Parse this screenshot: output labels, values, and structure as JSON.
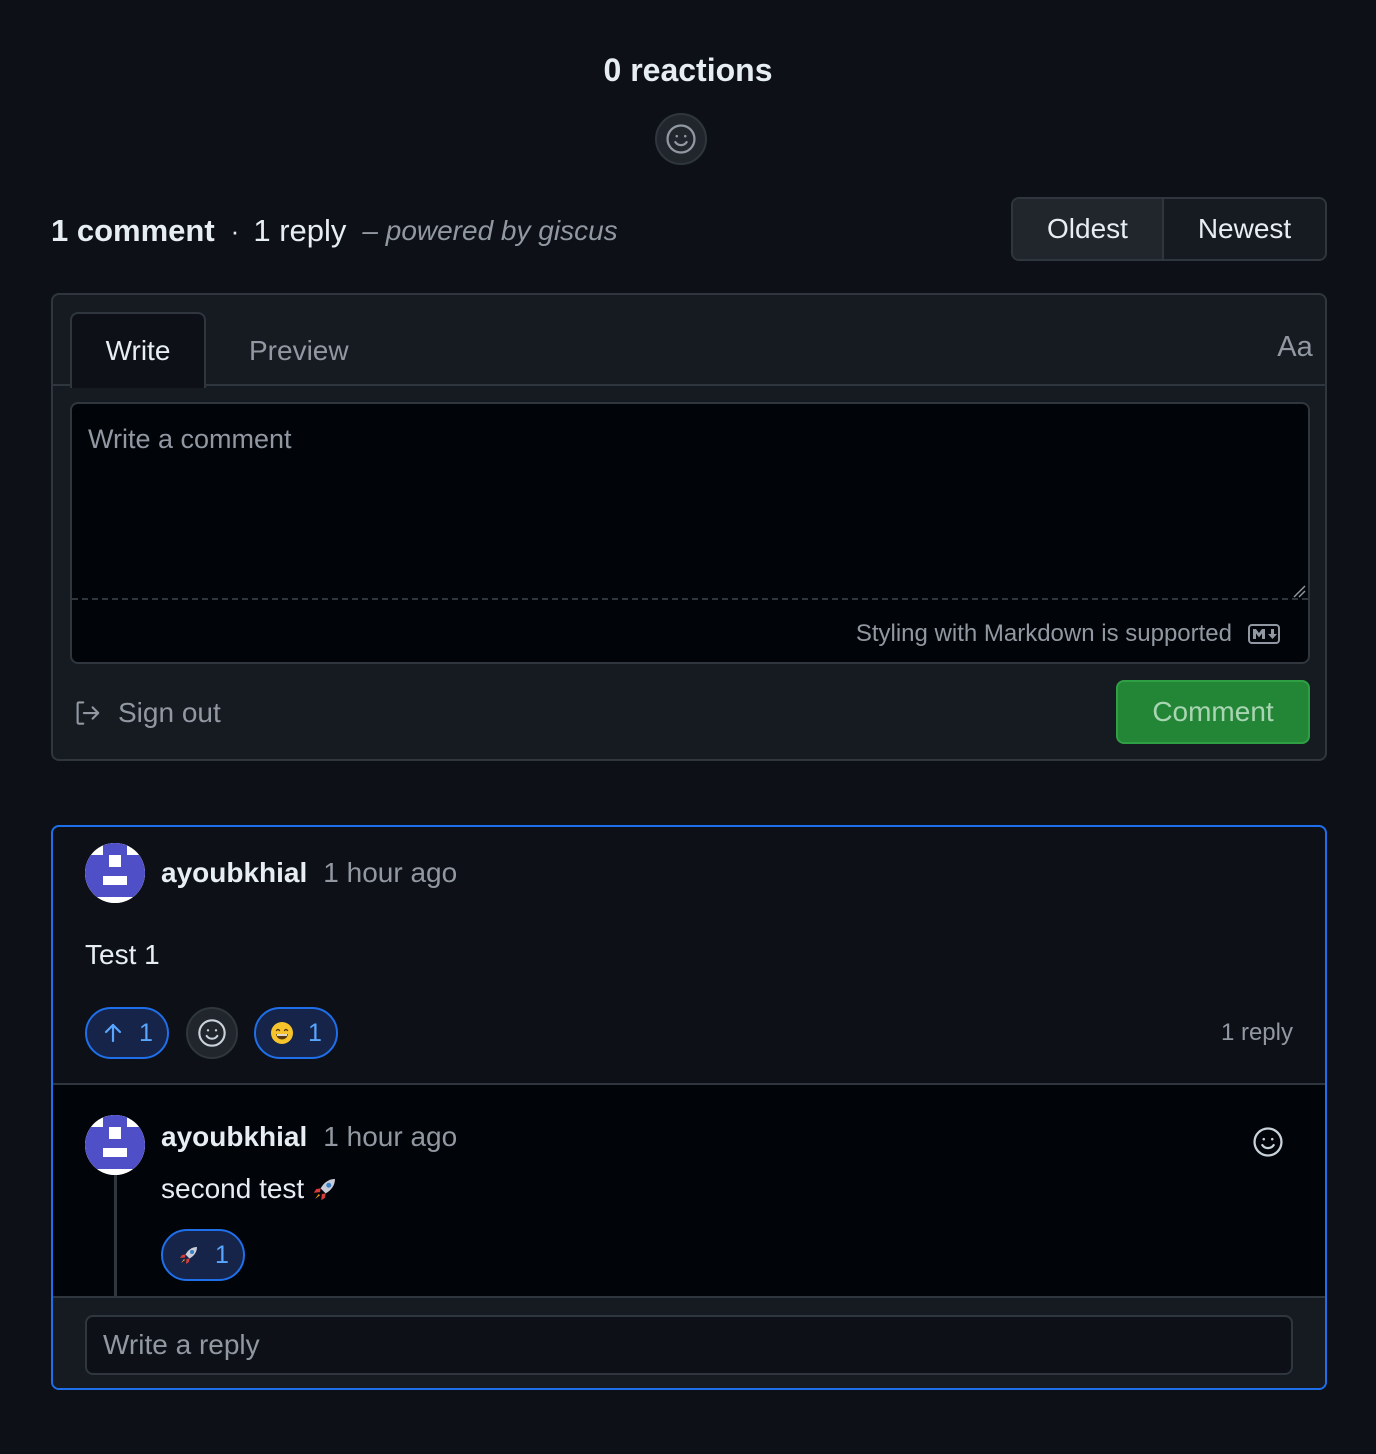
{
  "reactions": {
    "title": "0 reactions",
    "add_icon": "smiley-icon"
  },
  "counts": {
    "comments": "1 comment",
    "separator": "·",
    "replies": "1 reply",
    "powered_by": "– powered by giscus"
  },
  "sort": {
    "oldest": "Oldest",
    "newest": "Newest",
    "selected": "Oldest"
  },
  "editor": {
    "tab_write": "Write",
    "tab_preview": "Preview",
    "font_toggle": "Aa",
    "placeholder": "Write a comment",
    "markdown_hint": "Styling with Markdown is supported",
    "markdown_icon": "markdown-icon"
  },
  "actions": {
    "sign_out": "Sign out",
    "sign_out_icon": "sign-out-icon",
    "comment": "Comment"
  },
  "comment": {
    "author": "ayoubkhial",
    "time": "1 hour ago",
    "body": "Test 1",
    "reactions": [
      {
        "icon": "arrow-up-icon",
        "count": "1",
        "active": true
      },
      {
        "icon": "grinning-face-emoji",
        "count": "1",
        "active": true
      }
    ],
    "reply_count": "1 reply"
  },
  "reply": {
    "author": "ayoubkhial",
    "time": "1 hour ago",
    "body": "second test",
    "body_emoji": "rocket-emoji",
    "reactions": [
      {
        "icon": "rocket-emoji",
        "count": "1",
        "active": true
      }
    ]
  },
  "reply_input": {
    "placeholder": "Write a reply"
  },
  "colors": {
    "background": "#0d1117",
    "accent_blue": "#1f6feb",
    "comment_button": "#238636",
    "muted_text": "#9198a1",
    "avatar_primary": "#4f4fc8"
  }
}
